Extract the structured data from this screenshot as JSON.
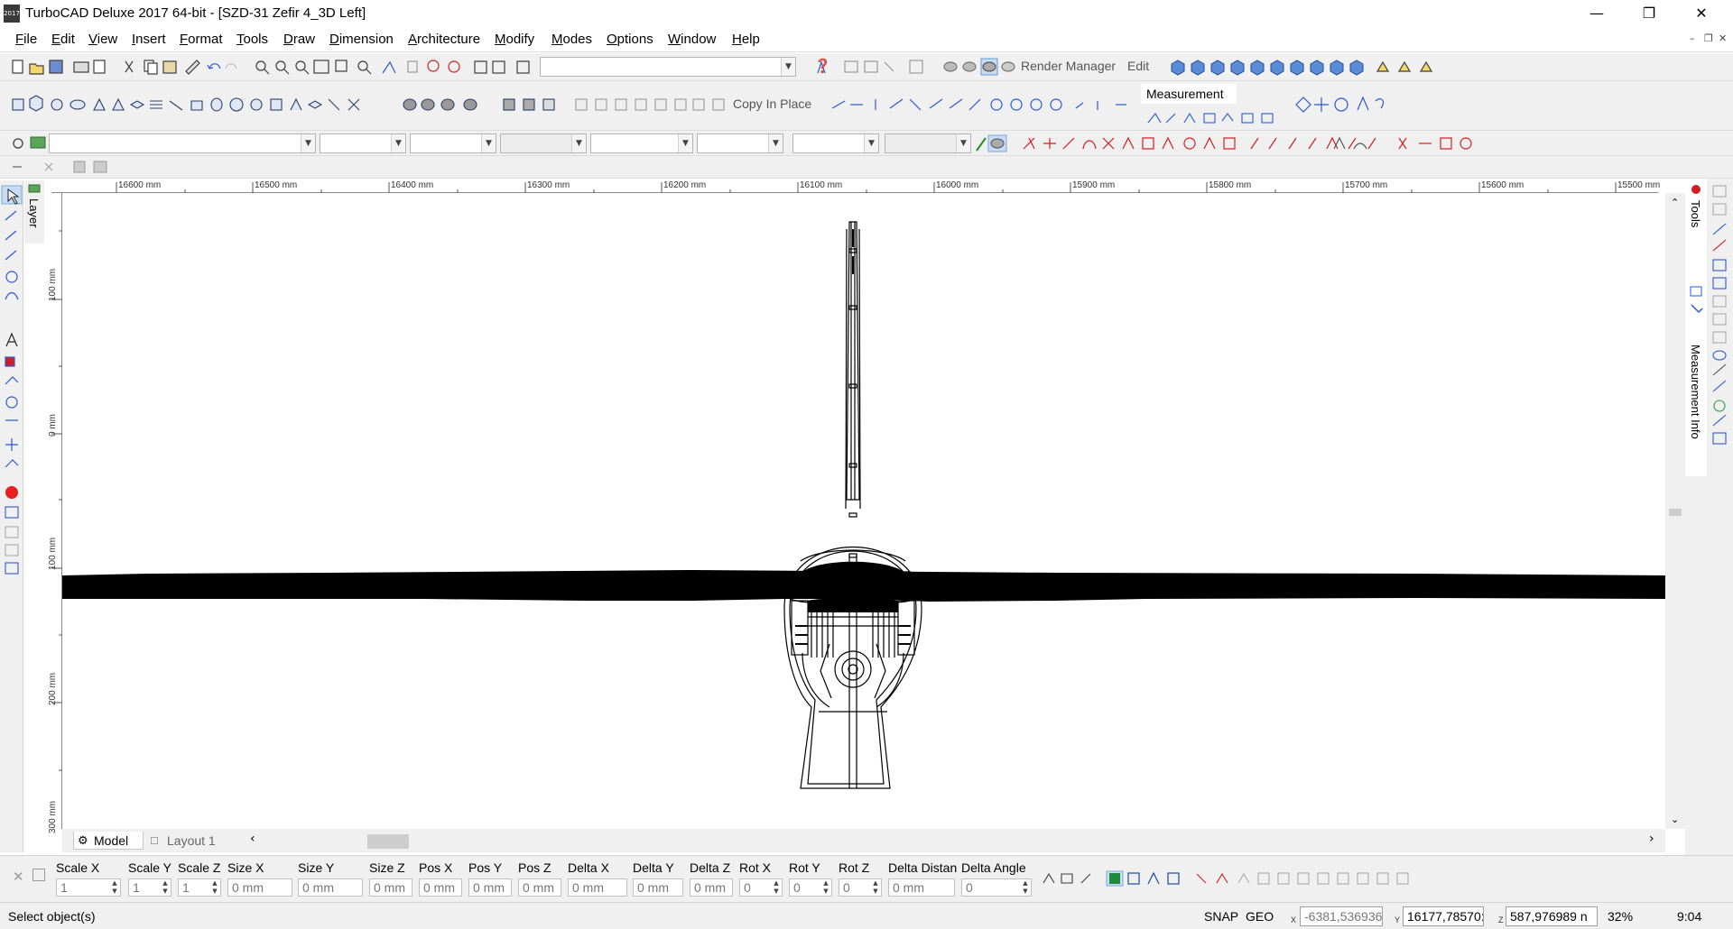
{
  "window": {
    "title": "TurboCAD Deluxe 2017 64-bit - [SZD-31 Zefir 4_3D Left]",
    "app_icon_text": "2017",
    "minimize_icon": "minimize-icon",
    "maximize_icon": "restore-icon",
    "close_icon": "close-icon"
  },
  "menubar": {
    "items": [
      "File",
      "Edit",
      "View",
      "Insert",
      "Format",
      "Tools",
      "Draw",
      "Dimension",
      "Architecture",
      "Modify",
      "Modes",
      "Options",
      "Window",
      "Help"
    ]
  },
  "toolbar1": {
    "render_manager_label": "Render Manager",
    "edit_label": "Edit"
  },
  "toolbar2": {
    "copy_in_place_label": "Copy In Place",
    "measurement_label": "Measurement"
  },
  "left_panel": {
    "layer_tab": "Layer"
  },
  "ruler": {
    "horizontal": [
      "16600 mm",
      "16500 mm",
      "16400 mm",
      "16300 mm",
      "16200 mm",
      "16100 mm",
      "16000 mm",
      "15900 mm",
      "15800 mm",
      "15700 mm",
      "15600 mm",
      "15500 mm"
    ],
    "vertical": [
      "100 mm",
      "0 mm",
      "100 mm",
      "200 mm",
      "300 mm"
    ]
  },
  "right_panel": {
    "tools_tab": "Tools",
    "measurement_info_tab": "Measurement Info"
  },
  "tabs": {
    "model": "Model",
    "layout": "Layout 1"
  },
  "inspector": {
    "fields": [
      {
        "label": "Scale X",
        "value": "1",
        "spin": true
      },
      {
        "label": "Scale Y",
        "value": "1",
        "spin": true
      },
      {
        "label": "Scale Z",
        "value": "1",
        "spin": true
      },
      {
        "label": "Size X",
        "value": "0 mm",
        "spin": false
      },
      {
        "label": "Size Y",
        "value": "0 mm",
        "spin": false
      },
      {
        "label": "Size Z",
        "value": "0 mm",
        "spin": false
      },
      {
        "label": "Pos X",
        "value": "0 mm",
        "spin": false
      },
      {
        "label": "Pos Y",
        "value": "0 mm",
        "spin": false
      },
      {
        "label": "Pos Z",
        "value": "0 mm",
        "spin": false
      },
      {
        "label": "Delta X",
        "value": "0 mm",
        "spin": false
      },
      {
        "label": "Delta Y",
        "value": "0 mm",
        "spin": false
      },
      {
        "label": "Delta Z",
        "value": "0 mm",
        "spin": false
      },
      {
        "label": "Rot X",
        "value": "0",
        "spin": true
      },
      {
        "label": "Rot Y",
        "value": "0",
        "spin": true
      },
      {
        "label": "Rot Z",
        "value": "0",
        "spin": true
      },
      {
        "label": "Delta Distan",
        "value": "0 mm",
        "spin": false
      },
      {
        "label": "Delta Angle",
        "value": "0",
        "spin": true
      }
    ]
  },
  "statusbar": {
    "prompt": "Select object(s)",
    "snap": "SNAP",
    "geo": "GEO",
    "x_label": "X",
    "x_value": "-6381,536936",
    "y_label": "Y",
    "y_value": "16177,78570:",
    "z_label": "Z",
    "z_value": "587,976989 n",
    "zoom": "32%",
    "time": "9:04"
  },
  "colors": {
    "accent_blue": "#2a5ad8",
    "accent_red": "#d21e1e",
    "accent_green": "#20a040",
    "toolbar_bg": "#f0f0f0"
  }
}
